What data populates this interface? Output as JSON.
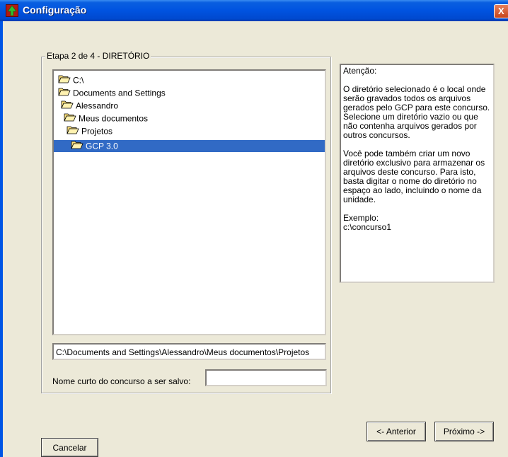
{
  "window": {
    "title": "Configuração",
    "close_glyph": "X"
  },
  "step": {
    "label": "Etapa 2 de 4 - DIRETÓRIO"
  },
  "tree": {
    "items": [
      {
        "label": "C:\\",
        "open": true,
        "selected": false
      },
      {
        "label": "Documents and Settings",
        "open": true,
        "selected": false
      },
      {
        "label": "Alessandro",
        "open": true,
        "selected": false
      },
      {
        "label": "Meus documentos",
        "open": true,
        "selected": false
      },
      {
        "label": "Projetos",
        "open": true,
        "selected": false
      },
      {
        "label": "GCP 3.0",
        "open": true,
        "selected": true
      }
    ]
  },
  "path_field": {
    "value": "C:\\Documents and Settings\\Alessandro\\Meus documentos\\Projetos"
  },
  "short_name": {
    "label": "Nome curto do concurso a ser salvo:",
    "value": ""
  },
  "attention": {
    "heading": "Atenção:",
    "para1": "O diretório selecionado é o local onde serão gravados todos os arquivos gerados pelo GCP para este concurso.",
    "para2": "Selecione um diretório vazio ou que não contenha arquivos gerados por outros concursos.",
    "para3": "Você pode também criar um novo diretório exclusivo para armazenar os arquivos deste concurso. Para isto, basta digitar o nome do diretório no espaço ao lado, incluindo o nome da unidade.",
    "example_label": "Exemplo:",
    "example_value": "c:\\concurso1"
  },
  "buttons": {
    "prev": "<- Anterior",
    "next": "Próximo ->",
    "cancel": "Cancelar"
  }
}
